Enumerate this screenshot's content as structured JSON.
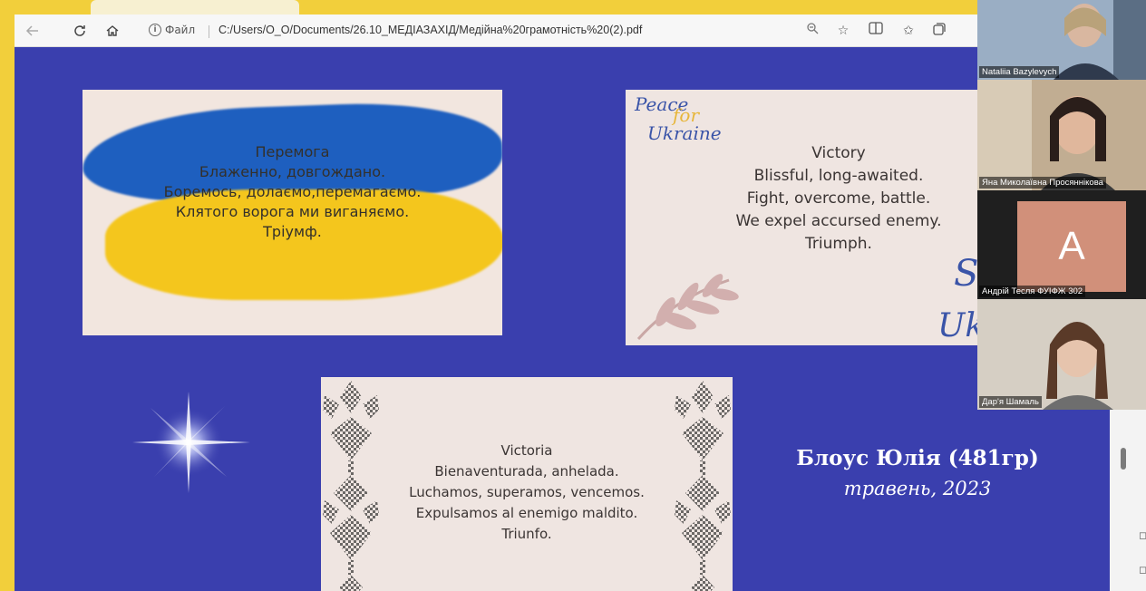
{
  "browser": {
    "info_label": "Файл",
    "url": "C:/Users/O_O/Documents/26.10_МЕДІАЗАХІД/Медійна%20грамотність%20(2).pdf",
    "icons": [
      "back-arrow-icon",
      "reload-icon",
      "home-icon",
      "info-icon",
      "zoom-icon",
      "star-icon",
      "reader-view-icon",
      "favorites-icon",
      "collections-icon"
    ]
  },
  "slides": {
    "ukrainian": {
      "title": "Перемога",
      "lines": [
        "Блаженно, довгождано.",
        "Боремось, долаємо,перемагаємо.",
        "Клятого ворога ми виганяємо.",
        "Тріумф."
      ]
    },
    "english": {
      "badge_lines": [
        "Peace",
        "for",
        "Ukraine"
      ],
      "title": "Victory",
      "lines": [
        "Blissful, long-awaited.",
        "Fight, overcome, battle.",
        "We expel accursed enemy.",
        "Triumph."
      ],
      "corner_script": [
        "S",
        "Uk"
      ]
    },
    "spanish": {
      "title": "Victoria",
      "lines": [
        "Bienaventurada, anhelada.",
        "Luchamos, superamos, vencemos.",
        "Expulsamos al enemigo maldito.",
        "Triunfo."
      ]
    },
    "author": {
      "name": "Блоус Юлія (481гр)",
      "date": "травень, 2023"
    }
  },
  "participants": [
    {
      "name": "Nataliia Bazylevych",
      "photo_bg": "#8a9db4"
    },
    {
      "name": "Яна Миколаївна Просяннікова",
      "photo_bg": "#b9a58c"
    },
    {
      "name": "Андрій Тесля ФУІФЖ 302",
      "avatar_letter": "A",
      "avatar_color": "#d1907a"
    },
    {
      "name": "Дар'я Шамаль",
      "photo_bg": "#c9c1b6"
    }
  ],
  "colors": {
    "slide_background": "#3a3fae",
    "ukraine_blue": "#1e5fbf",
    "ukraine_yellow": "#f4c61d",
    "frame_yellow": "#f2cf3b"
  }
}
